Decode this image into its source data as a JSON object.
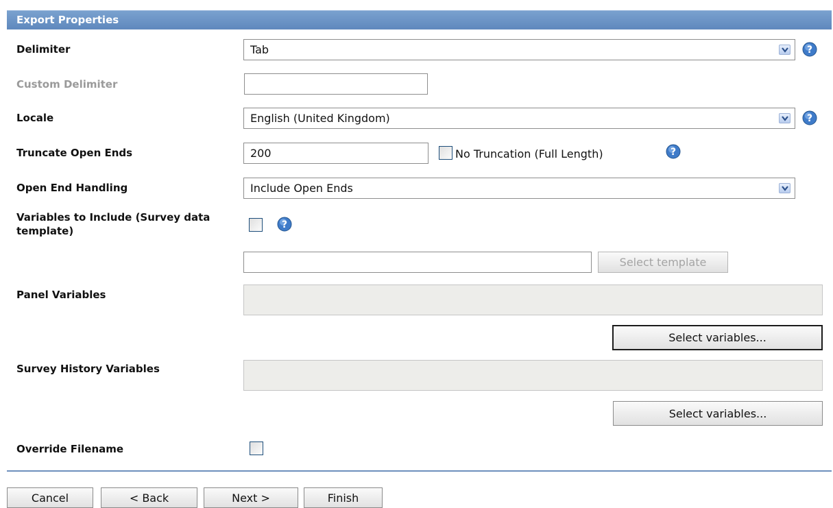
{
  "panel": {
    "title": "Export Properties"
  },
  "delimiter": {
    "label": "Delimiter",
    "value": "Tab"
  },
  "custom_delimiter": {
    "label": "Custom Delimiter",
    "value": ""
  },
  "locale": {
    "label": "Locale",
    "value": "English (United Kingdom)"
  },
  "truncate": {
    "label": "Truncate Open Ends",
    "value": "200",
    "no_truncation_label": "No Truncation (Full Length)",
    "no_truncation_checked": false
  },
  "open_end_handling": {
    "label": "Open End Handling",
    "value": "Include Open Ends"
  },
  "variables_to_include": {
    "label": "Variables to Include (Survey data template)",
    "checked": false,
    "template_value": "",
    "select_template_label": "Select template"
  },
  "panel_variables": {
    "label": "Panel Variables",
    "button_label": "Select variables..."
  },
  "survey_history_variables": {
    "label": "Survey History Variables",
    "button_label": "Select variables..."
  },
  "override_filename": {
    "label": "Override Filename",
    "checked": false
  },
  "footer": {
    "cancel": "Cancel",
    "back": "< Back",
    "next": "Next >",
    "finish": "Finish"
  },
  "icons": {
    "help": "help-icon",
    "dropdown": "chevron-down-icon"
  },
  "colors": {
    "header": "#6a91c4",
    "divider": "#6d8fbd"
  }
}
